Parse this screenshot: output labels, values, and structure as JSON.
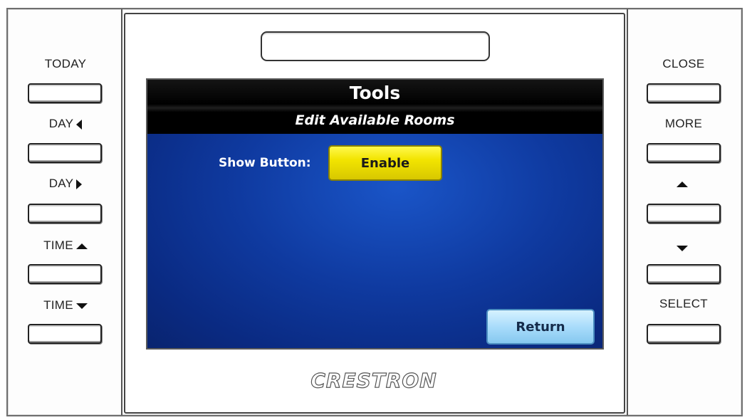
{
  "device": {
    "brand": "CRESTRON"
  },
  "left_buttons": [
    {
      "label": "TODAY",
      "icon": ""
    },
    {
      "label": "DAY",
      "icon": "triangle-left-icon"
    },
    {
      "label": "DAY",
      "icon": "triangle-right-icon"
    },
    {
      "label": "TIME",
      "icon": "triangle-up-icon"
    },
    {
      "label": "TIME",
      "icon": "triangle-down-icon"
    }
  ],
  "right_buttons": [
    {
      "label": "CLOSE",
      "icon": ""
    },
    {
      "label": "MORE",
      "icon": ""
    },
    {
      "label": "",
      "icon": "triangle-up-icon"
    },
    {
      "label": "",
      "icon": "triangle-down-icon"
    },
    {
      "label": "SELECT",
      "icon": ""
    }
  ],
  "screen": {
    "title": "Tools",
    "subtitle": "Edit Available Rooms",
    "show_button_label": "Show Button:",
    "enable_button": "Enable",
    "return_button": "Return"
  },
  "colors": {
    "screen_background": "#0f3aa0",
    "header_background": "#000000",
    "enable_button": "#f2e400",
    "return_button": "#a9dcfb"
  }
}
